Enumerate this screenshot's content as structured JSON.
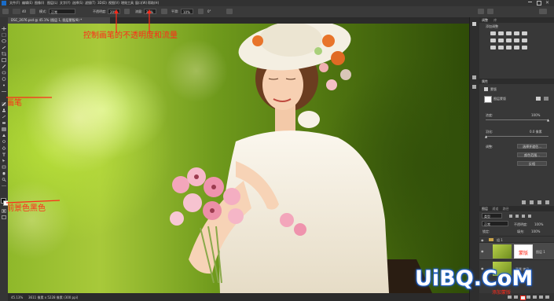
{
  "menubar": {
    "items": [
      "文件(F)",
      "编辑(E)",
      "图像(I)",
      "图层(L)",
      "文字(Y)",
      "选择(S)",
      "滤镜(T)",
      "3D(D)",
      "视图(V)",
      "增效工具",
      "窗口(W)",
      "帮助(H)"
    ]
  },
  "options": {
    "size": "40",
    "mode_label": "模式:",
    "mode_value": "正常",
    "opacity_label": "不透明度:",
    "opacity_value": "20%",
    "flow_label": "流量:",
    "flow_value": "20%",
    "smoothing_label": "平滑:",
    "smoothing_value": "10%",
    "angle_value": "0°"
  },
  "document": {
    "tab_title": "DSC_2076.psd @ 45.1% (图层 1, 图层蒙版/8) *"
  },
  "status": {
    "zoom": "45.13%",
    "info": "3611 像素 x 5228 像素 (300 ppi)"
  },
  "annotations": {
    "opacity_flow": "控制画笔的不透明度和流量",
    "brush": "画笔",
    "foreground": "前景色黑色",
    "mask": "蒙版",
    "add_mask": "添加蒙版"
  },
  "panels": {
    "adjustments_tab": "调整",
    "library_tab": "库",
    "add_adjustment": "添加调整",
    "properties_tab": "属性",
    "properties_type": "蒙版",
    "properties_layer_mask": "图层蒙版",
    "density_label": "浓度:",
    "density_value": "100%",
    "feather_label": "羽化:",
    "feather_value": "0.0 像素",
    "refine_label": "调整:",
    "select_mask_btn": "选择并遮住...",
    "color_range_btn": "颜色范围...",
    "invert_btn": "反相"
  },
  "layers": {
    "tabs": [
      "图层",
      "通道",
      "路径"
    ],
    "kind_label": "类型",
    "blend_mode": "正常",
    "opacity_label": "不透明度:",
    "opacity_value": "100%",
    "lock_label": "锁定:",
    "fill_label": "填充:",
    "fill_value": "100%",
    "group_name": "组 1",
    "layer1_name": "图层 1",
    "background_name": "背景 拷贝"
  },
  "watermark": "UiBQ.CoM",
  "colors": {
    "annotation": "#ff2a1a",
    "watermark_glow": "#2a6fd6"
  }
}
